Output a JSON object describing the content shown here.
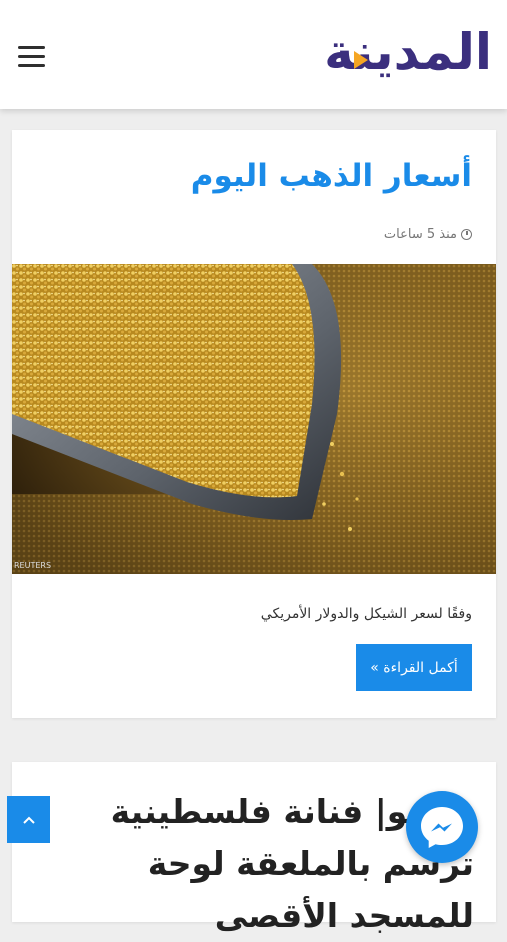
{
  "header": {
    "logo_text": "المدينة",
    "menu_icon": "hamburger-menu-icon"
  },
  "posts": [
    {
      "title": "أسعار الذهب اليوم",
      "time": "منذ 5 ساعات",
      "image_watermark": "REUTERS",
      "excerpt": "وفقًا لسعر الشيكل والدولار الأمريكي",
      "read_more": "أكمل القراءة »"
    },
    {
      "title": "فيديو| فنانة فلسطينية ترسم بالملعقة لوحة للمسجد الأقصى"
    }
  ],
  "floating": {
    "scroll_top_icon": "chevron-up-icon",
    "messenger_icon": "messenger-icon"
  },
  "colors": {
    "accent": "#1a8be8",
    "logo": "#3b2f7e",
    "logo_play": "#f5a623"
  }
}
